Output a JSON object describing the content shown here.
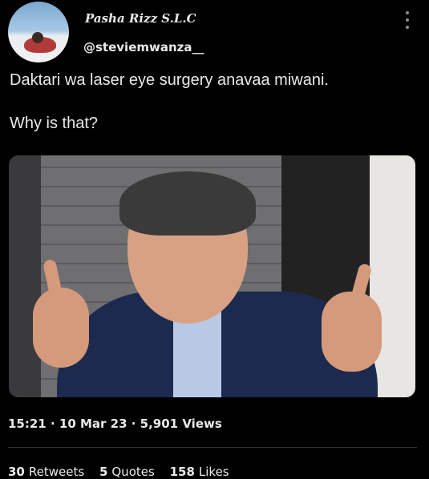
{
  "tweet": {
    "display_name": "Pasha Rizz S.L.C",
    "handle": "@steviemwanza__",
    "text_line1": "Daktari wa laser eye surgery anavaa miwani.",
    "text_line2": "Why is that?",
    "timestamp": "15:21 · 10 Mar 23 · 5,901 Views"
  },
  "icons": {
    "more": "more-vertical-icon"
  },
  "stats": {
    "retweets_count": "30",
    "retweets_label": "Retweets",
    "quotes_count": "5",
    "quotes_label": "Quotes",
    "likes_count": "158",
    "likes_label": "Likes"
  },
  "colors": {
    "background": "#000000",
    "text": "#e7e9ea",
    "divider": "#2f3336"
  }
}
